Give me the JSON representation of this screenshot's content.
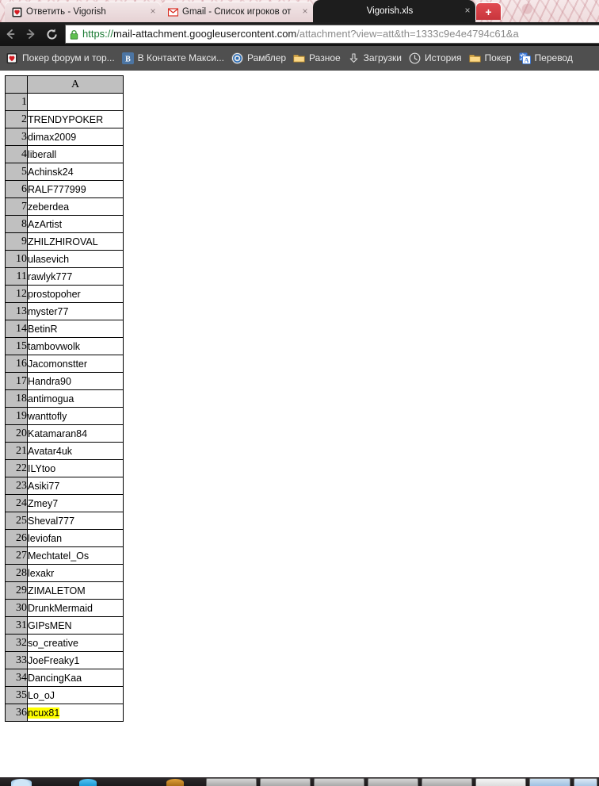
{
  "browser": {
    "tabs": [
      {
        "title": "Ответить - Vigorish",
        "favicon": "poker-card-icon",
        "active": false,
        "close_label": "×"
      },
      {
        "title": "Gmail - Список игроков от",
        "favicon": "gmail-icon",
        "active": false,
        "close_label": "×"
      },
      {
        "title": "Vigorish.xls",
        "favicon": "none",
        "active": true,
        "close_label": "×"
      }
    ],
    "new_tab_label": "+",
    "toolbar": {
      "back_icon": "back-arrow-icon",
      "forward_icon": "forward-arrow-icon",
      "reload_icon": "reload-icon",
      "lock_icon": "lock-icon",
      "url": {
        "scheme": "https://",
        "host": "mail-attachment.googleusercontent.com",
        "rest": "/attachment?view=att&th=1333c9e4e4794c61&a"
      }
    },
    "bookmarks": [
      {
        "label": "Покер форум и тор...",
        "icon": "poker-card-icon"
      },
      {
        "label": "В Контакте  Макси...",
        "icon": "vk-icon"
      },
      {
        "label": "Рамблер",
        "icon": "rambler-icon"
      },
      {
        "label": "Разное",
        "icon": "folder-icon"
      },
      {
        "label": "Загрузки",
        "icon": "download-icon"
      },
      {
        "label": "История",
        "icon": "clock-icon"
      },
      {
        "label": "Покер",
        "icon": "folder-icon"
      },
      {
        "label": "Перевод",
        "icon": "translate-icon"
      }
    ]
  },
  "spreadsheet": {
    "corner_label": "",
    "column_headers": [
      "A"
    ],
    "highlight_color": "#ffff00",
    "rows": [
      {
        "num": "1",
        "a": "",
        "highlighted": false
      },
      {
        "num": "2",
        "a": "TRENDYPOKER",
        "highlighted": false
      },
      {
        "num": "3",
        "a": "dimax2009",
        "highlighted": false
      },
      {
        "num": "4",
        "a": "liberall",
        "highlighted": false
      },
      {
        "num": "5",
        "a": "Achinsk24",
        "highlighted": false
      },
      {
        "num": "6",
        "a": "RALF777999",
        "highlighted": false
      },
      {
        "num": "7",
        "a": "zeberdea",
        "highlighted": false
      },
      {
        "num": "8",
        "a": "AzArtist",
        "highlighted": false
      },
      {
        "num": "9",
        "a": "ZHILZHIROVAL",
        "highlighted": false
      },
      {
        "num": "10",
        "a": "ulasevich",
        "highlighted": false
      },
      {
        "num": "11",
        "a": "rawlyk777",
        "highlighted": false
      },
      {
        "num": "12",
        "a": "prostopoher",
        "highlighted": false
      },
      {
        "num": "13",
        "a": "myster77",
        "highlighted": false
      },
      {
        "num": "14",
        "a": "BetinR",
        "highlighted": false
      },
      {
        "num": "15",
        "a": "tambovwolk",
        "highlighted": false
      },
      {
        "num": "16",
        "a": "Jacomonstter",
        "highlighted": false
      },
      {
        "num": "17",
        "a": "Handra90",
        "highlighted": false
      },
      {
        "num": "18",
        "a": "antimogua",
        "highlighted": false
      },
      {
        "num": "19",
        "a": "wanttofly",
        "highlighted": false
      },
      {
        "num": "20",
        "a": "Katamaran84",
        "highlighted": false
      },
      {
        "num": "21",
        "a": "Avatar4uk",
        "highlighted": false
      },
      {
        "num": "22",
        "a": "ILYtoo",
        "highlighted": false
      },
      {
        "num": "23",
        "a": "Asiki77",
        "highlighted": false
      },
      {
        "num": "24",
        "a": "Zmey7",
        "highlighted": false
      },
      {
        "num": "25",
        "a": "Sheval777",
        "highlighted": false
      },
      {
        "num": "26",
        "a": "leviofan",
        "highlighted": false
      },
      {
        "num": "27",
        "a": "Mechtatel_Os",
        "highlighted": false
      },
      {
        "num": "28",
        "a": "lexakr",
        "highlighted": false
      },
      {
        "num": "29",
        "a": "ZIMALETOM",
        "highlighted": false
      },
      {
        "num": "30",
        "a": "DrunkMermaid",
        "highlighted": false
      },
      {
        "num": "31",
        "a": "GIPsMEN",
        "highlighted": false
      },
      {
        "num": "32",
        "a": "so_creative",
        "highlighted": false
      },
      {
        "num": "33",
        "a": "JoeFreaky1",
        "highlighted": false
      },
      {
        "num": "34",
        "a": "DancingKaa",
        "highlighted": false
      },
      {
        "num": "35",
        "a": "Lo_oJ",
        "highlighted": false
      },
      {
        "num": "36",
        "a": "ncux81",
        "highlighted": true
      }
    ]
  }
}
